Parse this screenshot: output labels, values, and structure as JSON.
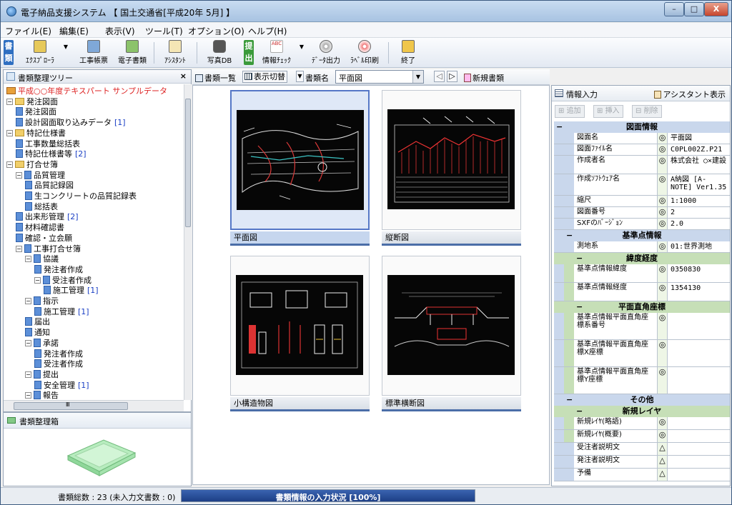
{
  "window": {
    "title": "電子納品支援システム 【 国土交通省[平成20年 5月] 】",
    "min": "–",
    "max": "□",
    "close": "X"
  },
  "menu": [
    "ファイル(E)",
    "編集(E)",
    "表示(V)",
    "ツール(T)",
    "オプション(O)",
    "ヘルプ(H)"
  ],
  "toolbar": {
    "badge1": "書類",
    "explorer": "ｴｸｽﾌﾟﾛｰﾗ",
    "ledger": "工事帳票",
    "edoc": "電子書類",
    "assistant": "ｱｼｽﾀﾝﾄ",
    "photodb": "写真DB",
    "badge2": "提出",
    "infocheck": "情報ﾁｪｯｸ",
    "dataout": "ﾃﾞｰﾀ出力",
    "label": "ﾗﾍﾞﾙ印刷",
    "exit": "終了",
    "check_tag": "ABC"
  },
  "tree_panel": {
    "title": "書類整理ツリー",
    "close": "×"
  },
  "tree": [
    {
      "label": "平成○○年度テキスパート サンプルデータ",
      "depth": 0,
      "kind": "root",
      "exp": "",
      "count": ""
    },
    {
      "label": "発注図面",
      "depth": 0,
      "kind": "folder",
      "exp": "−",
      "count": ""
    },
    {
      "label": "発注図面",
      "depth": 1,
      "kind": "doc",
      "exp": "",
      "count": ""
    },
    {
      "label": "設計図面取り込みデータ",
      "depth": 1,
      "kind": "doc",
      "exp": "",
      "count": "[1]"
    },
    {
      "label": "特記仕様書",
      "depth": 0,
      "kind": "folder",
      "exp": "−",
      "count": ""
    },
    {
      "label": "工事数量総括表",
      "depth": 1,
      "kind": "doc",
      "exp": "",
      "count": ""
    },
    {
      "label": "特記仕様書等",
      "depth": 1,
      "kind": "doc",
      "exp": "",
      "count": "[2]"
    },
    {
      "label": "打合せ簿",
      "depth": 0,
      "kind": "folder",
      "exp": "−",
      "count": ""
    },
    {
      "label": "品質管理",
      "depth": 1,
      "kind": "doc",
      "exp": "−",
      "count": ""
    },
    {
      "label": "品質記録図",
      "depth": 2,
      "kind": "doc",
      "exp": "",
      "count": ""
    },
    {
      "label": "生コンクリートの品質記録表",
      "depth": 2,
      "kind": "doc",
      "exp": "",
      "count": ""
    },
    {
      "label": "総括表",
      "depth": 2,
      "kind": "doc",
      "exp": "",
      "count": ""
    },
    {
      "label": "出来形管理",
      "depth": 1,
      "kind": "doc",
      "exp": "",
      "count": "[2]"
    },
    {
      "label": "材料確認書",
      "depth": 1,
      "kind": "doc",
      "exp": "",
      "count": ""
    },
    {
      "label": "確認・立会願",
      "depth": 1,
      "kind": "doc",
      "exp": "",
      "count": ""
    },
    {
      "label": "工事打合せ簿",
      "depth": 1,
      "kind": "doc",
      "exp": "−",
      "count": ""
    },
    {
      "label": "協議",
      "depth": 2,
      "kind": "doc",
      "exp": "−",
      "count": ""
    },
    {
      "label": "発注者作成",
      "depth": 3,
      "kind": "doc",
      "exp": "",
      "count": ""
    },
    {
      "label": "受注者作成",
      "depth": 3,
      "kind": "doc",
      "exp": "−",
      "count": ""
    },
    {
      "label": "施工管理",
      "depth": 4,
      "kind": "doc",
      "exp": "",
      "count": "[1]"
    },
    {
      "label": "指示",
      "depth": 2,
      "kind": "doc",
      "exp": "−",
      "count": ""
    },
    {
      "label": "施工管理",
      "depth": 3,
      "kind": "doc",
      "exp": "",
      "count": "[1]"
    },
    {
      "label": "届出",
      "depth": 2,
      "kind": "doc",
      "exp": "",
      "count": ""
    },
    {
      "label": "通知",
      "depth": 2,
      "kind": "doc",
      "exp": "",
      "count": ""
    },
    {
      "label": "承諾",
      "depth": 2,
      "kind": "doc",
      "exp": "−",
      "count": ""
    },
    {
      "label": "発注者作成",
      "depth": 3,
      "kind": "doc",
      "exp": "",
      "count": ""
    },
    {
      "label": "受注者作成",
      "depth": 3,
      "kind": "doc",
      "exp": "",
      "count": ""
    },
    {
      "label": "提出",
      "depth": 2,
      "kind": "doc",
      "exp": "−",
      "count": ""
    },
    {
      "label": "安全管理",
      "depth": 3,
      "kind": "doc",
      "exp": "",
      "count": "[1]"
    },
    {
      "label": "報告",
      "depth": 2,
      "kind": "doc",
      "exp": "−",
      "count": ""
    }
  ],
  "scroll": {
    "h_mark": "Ⅲ"
  },
  "box_panel": {
    "title": "書類整理箱"
  },
  "center_header": {
    "list_label": "書類一覧",
    "toggle_label": "表示切替",
    "name_label": "書類名",
    "name_value": "平面図",
    "new_label": "新規書類"
  },
  "thumbnails": [
    {
      "caption": "平面図",
      "selected": true
    },
    {
      "caption": "縦断図",
      "selected": false
    },
    {
      "caption": "小構造物図",
      "selected": false
    },
    {
      "caption": "標準横断図",
      "selected": false
    }
  ],
  "info_panel": {
    "title": "情報入力",
    "assistant": "アシスタント表示",
    "btn_add": "追加",
    "btn_insert": "挿入",
    "btn_delete": "削除"
  },
  "props": {
    "sec_drawing": "図面情報",
    "rows_drawing": [
      {
        "label": "図面名",
        "mark": "◎",
        "value": "平面図"
      },
      {
        "label": "図面ﾌｧｲﾙ名",
        "mark": "◎",
        "value": "C0PL002Z.P21"
      },
      {
        "label": "作成者名",
        "mark": "◎",
        "value": "株式会社 ○×建設"
      },
      {
        "label": "作成ｿﾌﾄｳｪｱ名",
        "mark": "◎",
        "value": "A納図 [A-NOTE] Ver1.35"
      },
      {
        "label": "縮尺",
        "mark": "◎",
        "value": "1:1000"
      },
      {
        "label": "図面番号",
        "mark": "◎",
        "value": "2"
      },
      {
        "label": "SXFのﾊﾞｰｼﾞｮﾝ",
        "mark": "◎",
        "value": "2.0"
      }
    ],
    "sec_ref": "基準点情報",
    "row_survey": {
      "label": "測地系",
      "mark": "◎",
      "value": "01:世界測地"
    },
    "sec_latlon": "緯度経度",
    "rows_latlon": [
      {
        "label": "基準点情報緯度",
        "mark": "◎",
        "value": "0350830"
      },
      {
        "label": "基準点情報経度",
        "mark": "◎",
        "value": "1354130"
      }
    ],
    "sec_plane": "平面直角座標",
    "rows_plane": [
      {
        "label": "基準点情報平面直角座標系番号",
        "mark": "◎",
        "value": ""
      },
      {
        "label": "基準点情報平面直角座標X座標",
        "mark": "◎",
        "value": ""
      },
      {
        "label": "基準点情報平面直角座標Y座標",
        "mark": "◎",
        "value": ""
      }
    ],
    "sec_other": "その他",
    "sec_newlayer": "新規レイヤ",
    "rows_layer": [
      {
        "label": "新規ﾚｲﾔ(略語)",
        "mark": "◎",
        "value": ""
      },
      {
        "label": "新規ﾚｲﾔ(概要)",
        "mark": "◎",
        "value": ""
      }
    ],
    "rows_other": [
      {
        "label": "受注者説明文",
        "mark": "△",
        "value": ""
      },
      {
        "label": "発注者説明文",
        "mark": "△",
        "value": ""
      },
      {
        "label": "予備",
        "mark": "△",
        "value": ""
      }
    ],
    "collapse": "−"
  },
  "status": {
    "summary": "書類総数 : 23 (未入力文書数 : 0)",
    "progress_label": "書類情報の入力状況 [100%]",
    "progress_fraction": 1.0
  }
}
